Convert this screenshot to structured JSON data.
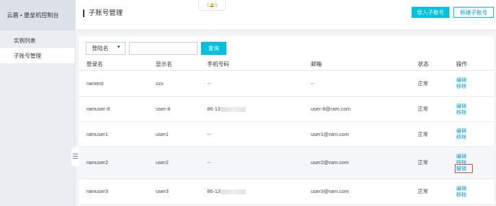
{
  "sidebar": {
    "brand": "云盾 • 堡垒机控制台",
    "items": [
      {
        "label": "实例列表"
      },
      {
        "label": "子账号管理"
      }
    ],
    "collapse_glyph": "☰"
  },
  "header": {
    "title": "子账号管理",
    "notification_glyph": "((🔔))",
    "import_button": "导入子账号",
    "new_button": "新建子账号"
  },
  "filter": {
    "select_value": "登陆名",
    "select_caret": "▼",
    "search_placeholder": "",
    "search_button": "查询"
  },
  "table": {
    "columns": [
      "登录名",
      "显示名",
      "手机号码",
      "邮箱",
      "状态",
      "操作"
    ],
    "rows": [
      {
        "login": "ramtest",
        "display": "zzx",
        "phone": "--",
        "email": "--",
        "status": "正常",
        "actions": [
          "编辑",
          "移除"
        ]
      },
      {
        "login": "ramuser-8",
        "display": "user-8",
        "phone": "86-13",
        "email": "user-8@ram.com",
        "status": "正常",
        "actions": [
          "编辑",
          "移除"
        ]
      },
      {
        "login": "ramuser1",
        "display": "user1",
        "phone": "--",
        "email": "user1@ram.com",
        "status": "正常",
        "actions": [
          "编辑",
          "移除"
        ]
      },
      {
        "login": "ramuser2",
        "display": "user2",
        "phone": "--",
        "email": "user2@ram.com",
        "status": "正常",
        "actions": [
          "编辑",
          "移除",
          "解锁"
        ]
      },
      {
        "login": "ramuser3",
        "display": "user3",
        "phone": "86-13",
        "email": "user3@ram.com",
        "status": "正常",
        "actions": [
          "编辑",
          "移除"
        ]
      }
    ]
  },
  "colors": {
    "accent": "#00c1de",
    "link": "#00a0d6",
    "highlight_box": "#e2463c"
  }
}
